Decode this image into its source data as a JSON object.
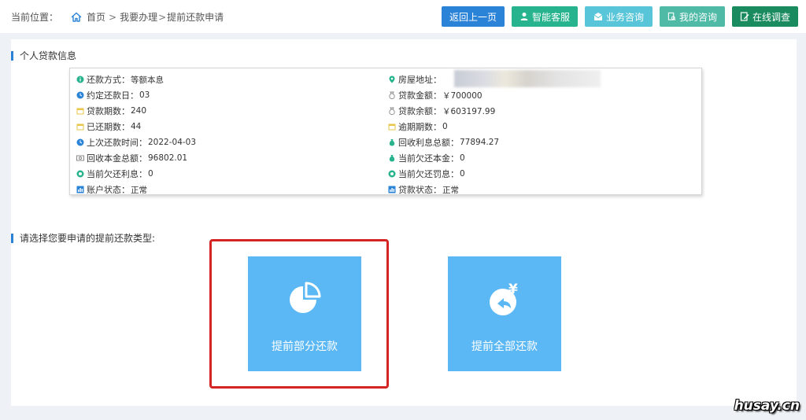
{
  "breadcrumb": {
    "label": "当前位置：",
    "items": [
      "首页",
      "我要办理",
      "提前还款申请"
    ],
    "sep": ">"
  },
  "toolbar": {
    "back": "返回上一页",
    "kefu": "智能客服",
    "zixun": "业务咨询",
    "mine": "我的咨询",
    "survey": "在线调查"
  },
  "sections": {
    "loan_info_title": "个人贷款信息",
    "choose_title": "请选择您要申请的提前还款类型:"
  },
  "loan_info": {
    "left": [
      {
        "k": "还款方式：",
        "v": "等额本息",
        "icon": "info-icon",
        "color": "#27b38d"
      },
      {
        "k": "约定还款日：",
        "v": "03",
        "icon": "clock-icon",
        "color": "#2b83d8"
      },
      {
        "k": "贷款期数：",
        "v": "240",
        "icon": "calendar-icon",
        "color": "#e8c64a"
      },
      {
        "k": "已还期数：",
        "v": "44",
        "icon": "calendar-icon",
        "color": "#e8c64a"
      },
      {
        "k": "上次还款时间：",
        "v": "2022-04-03",
        "icon": "clock-icon",
        "color": "#2b83d8"
      },
      {
        "k": "回收本金总额：",
        "v": "96802.01",
        "icon": "money-icon",
        "color": "#888888"
      },
      {
        "k": "当前欠还利息：",
        "v": "0",
        "icon": "coin-icon",
        "color": "#27b38d"
      },
      {
        "k": "账户状态：",
        "v": "正常",
        "icon": "chart-icon",
        "color": "#2b83d8"
      }
    ],
    "right": [
      {
        "k": "房屋地址：",
        "v": "",
        "icon": "location-icon",
        "color": "#27b38d"
      },
      {
        "k": "贷款金额：",
        "v": "￥700000",
        "icon": "bag-icon",
        "color": "#888888"
      },
      {
        "k": "贷款余额：",
        "v": "￥603197.99",
        "icon": "bag-icon",
        "color": "#888888"
      },
      {
        "k": "逾期期数：",
        "v": "0",
        "icon": "calendar-icon",
        "color": "#e8c64a"
      },
      {
        "k": "回收利息总额：",
        "v": "77894.27",
        "icon": "moneybag-icon",
        "color": "#27b38d"
      },
      {
        "k": "当前欠还本金：",
        "v": "0",
        "icon": "moneybag-icon",
        "color": "#27b38d"
      },
      {
        "k": "当前欠还罚息：",
        "v": "0",
        "icon": "coin-icon",
        "color": "#27b38d"
      },
      {
        "k": "贷款状态：",
        "v": "正常",
        "icon": "chart-icon",
        "color": "#2b83d8"
      }
    ]
  },
  "options": {
    "partial": "提前部分还款",
    "full": "提前全部还款"
  },
  "watermark": "husay.cn"
}
